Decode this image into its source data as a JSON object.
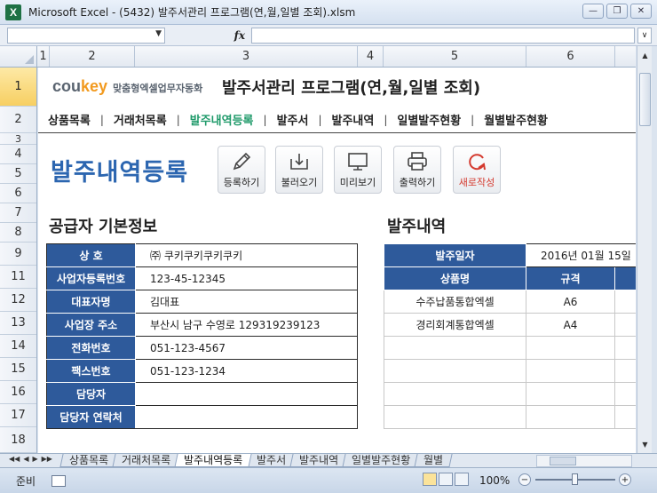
{
  "window": {
    "app_icon": "X",
    "title": "Microsoft Excel - (5432) 발주서관리 프로그램(연,월,일별 조회).xlsm",
    "controls": [
      "minimize",
      "restore",
      "close"
    ]
  },
  "formula_bar": {
    "namebox_value": "",
    "fx_label": "fx",
    "formula_value": ""
  },
  "columns": [
    "1",
    "2",
    "3",
    "4",
    "5",
    "6"
  ],
  "rows": [
    "1",
    "2",
    "3",
    "4",
    "5",
    "6",
    "7",
    "8",
    "9",
    "11",
    "12",
    "13",
    "14",
    "15",
    "16",
    "17",
    "18"
  ],
  "brand": {
    "cou": "cou",
    "key": "key",
    "tagline": "맞춤형엑셀업무자동화"
  },
  "program_title": "발주서관리 프로그램(연,월,일별 조회)",
  "menu": {
    "items": [
      "상품목록",
      "거래처목록",
      "발주내역등록",
      "발주서",
      "발주내역",
      "일별발주현황",
      "월별발주현황"
    ],
    "active": "발주내역등록"
  },
  "page_title": "발주내역등록",
  "toolbar": {
    "register": "등록하기",
    "load": "불러오기",
    "preview": "미리보기",
    "print": "출력하기",
    "new": "새로작성"
  },
  "supplier": {
    "section_title": "공급자 기본정보",
    "fields": [
      {
        "label": "상 호",
        "value": "㈜ 쿠키쿠키쿠키쿠키"
      },
      {
        "label": "사업자등록번호",
        "value": "123-45-12345"
      },
      {
        "label": "대표자명",
        "value": "김대표"
      },
      {
        "label": "사업장 주소",
        "value": "부산시 남구 수영로 129319239123"
      },
      {
        "label": "전화번호",
        "value": "051-123-4567"
      },
      {
        "label": "팩스번호",
        "value": "051-123-1234"
      },
      {
        "label": "담당자",
        "value": ""
      },
      {
        "label": "담당자 연락처",
        "value": ""
      }
    ]
  },
  "order": {
    "section_title": "발주내역",
    "date_label": "발주일자",
    "date_value": "2016년 01월 15일",
    "headers": [
      "상품명",
      "규격"
    ],
    "items": [
      {
        "name": "수주납품통합엑셀",
        "spec": "A6"
      },
      {
        "name": "경리회계통합엑셀",
        "spec": "A4"
      },
      {
        "name": "",
        "spec": ""
      },
      {
        "name": "",
        "spec": ""
      },
      {
        "name": "",
        "spec": ""
      },
      {
        "name": "",
        "spec": ""
      }
    ]
  },
  "sheet_tabs": {
    "items": [
      "상품목록",
      "거래처목록",
      "발주내역등록",
      "발주서",
      "발주내역",
      "일별발주현황",
      "월별"
    ],
    "active": "발주내역등록"
  },
  "status": {
    "ready": "준비",
    "zoom": "100%"
  },
  "colors": {
    "header_blue": "#2e5a9b",
    "title_blue": "#2c66b0",
    "menu_active": "#1f9a6a",
    "new_red": "#d43a2f"
  }
}
